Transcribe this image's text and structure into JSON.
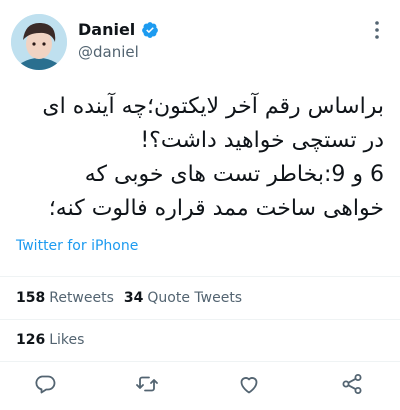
{
  "author": {
    "name": "Daniel",
    "handle": "@daniel"
  },
  "tweet": {
    "lines": [
      "براساس رقم آخر لایکتون؛چه آینده ای",
      "در تستچی خواهید داشت؟!",
      "6 و 9:بخاطر تست های خوبی که",
      "خواهی ساخت ممد قراره فالوت کنه؛"
    ],
    "source": "Twitter for iPhone"
  },
  "stats": {
    "retweets_count": "158",
    "retweets_label": "Retweets",
    "quote_count": "34",
    "quote_label": "Quote Tweets",
    "likes_count": "126",
    "likes_label": "Likes"
  },
  "colors": {
    "accent": "#1d9bf0",
    "text": "#0f1419",
    "muted": "#536471"
  },
  "icons": [
    "verified-badge-icon",
    "more-options-icon",
    "reply-icon",
    "retweet-icon",
    "like-icon",
    "share-icon"
  ]
}
